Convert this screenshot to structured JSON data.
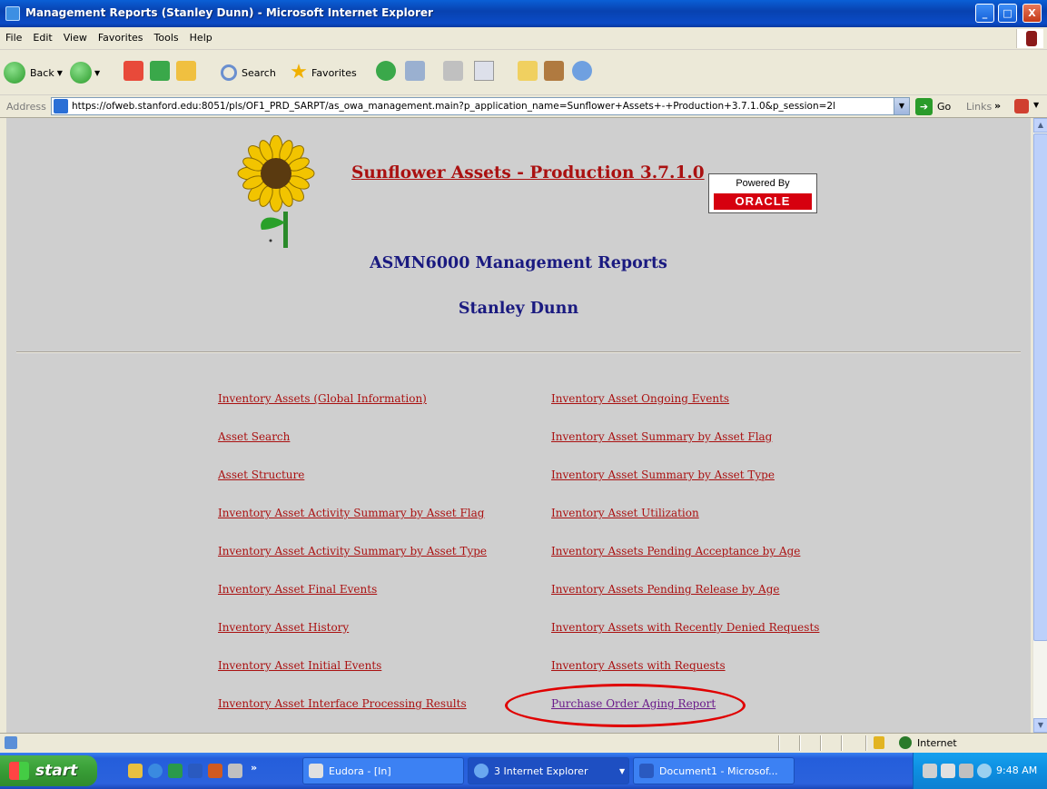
{
  "window": {
    "title": "Management Reports (Stanley Dunn) - Microsoft Internet Explorer",
    "minimize": "_",
    "maximize": "□",
    "close": "X"
  },
  "menu": [
    "File",
    "Edit",
    "View",
    "Favorites",
    "Tools",
    "Help"
  ],
  "toolbar": {
    "back_label": "Back",
    "search_label": "Search",
    "favorites_label": "Favorites"
  },
  "address": {
    "label": "Address",
    "url": "https://ofweb.stanford.edu:8051/pls/OF1_PRD_SARPT/as_owa_management.main?p_application_name=Sunflower+Assets+-+Production+3.7.1.0&p_session=2l",
    "go_label": "Go",
    "links_label": "Links"
  },
  "page": {
    "app_title": "Sunflower Assets - Production 3.7.1.0",
    "powered_by": "Powered By",
    "oracle_logo": "ORACLE",
    "heading": "ASMN6000 Management Reports",
    "user_name": "Stanley Dunn",
    "left_links": [
      "Inventory Assets (Global Information)",
      "Asset Search",
      "Asset Structure",
      "Inventory Asset Activity Summary by Asset Flag",
      "Inventory Asset Activity Summary by Asset Type",
      "Inventory Asset Final Events",
      "Inventory Asset History",
      "Inventory Asset Initial Events",
      "Inventory Asset Interface Processing Results"
    ],
    "right_links": [
      "Inventory Asset Ongoing Events",
      "Inventory Asset Summary by Asset Flag",
      "Inventory Asset Summary by Asset Type",
      "Inventory Asset Utilization",
      "Inventory Assets Pending Acceptance by Age",
      "Inventory Assets Pending Release by Age",
      "Inventory Assets with Recently Denied Requests",
      "Inventory Assets with Requests",
      "Purchase Order Aging Report"
    ]
  },
  "status": {
    "zone": "Internet"
  },
  "taskbar": {
    "start_label": "start",
    "tasks": [
      "Eudora - [In]",
      "3 Internet Explorer",
      "Document1 - Microsof..."
    ],
    "clock": "9:48 AM"
  },
  "colors": {
    "link": "#aa1111",
    "visited_link": "#6a1a8a",
    "heading": "#1a1a80",
    "highlight_ellipse": "#e00000"
  }
}
